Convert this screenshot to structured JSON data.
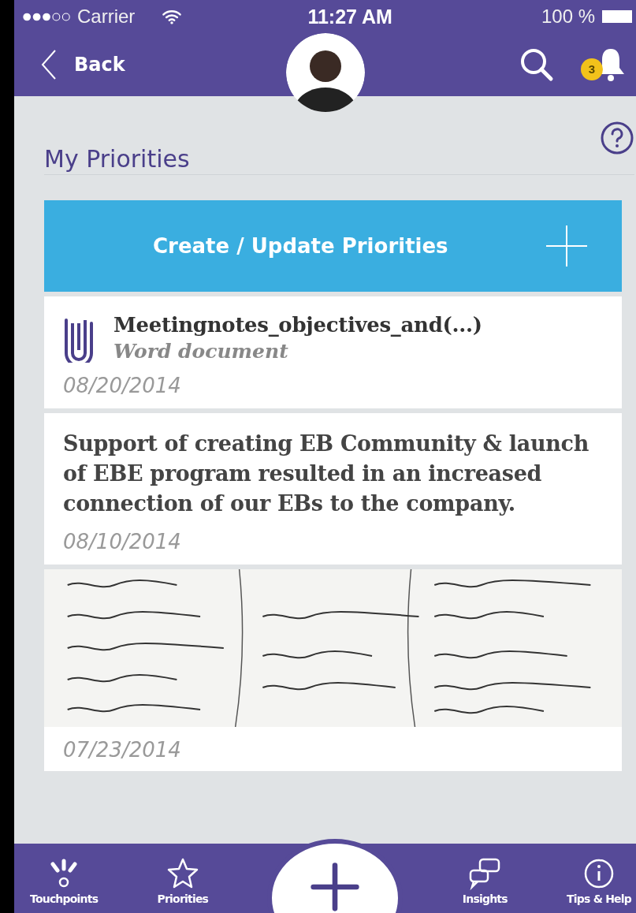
{
  "status_bar": {
    "carrier": "Carrier",
    "time": "11:27 AM",
    "battery": "100 %"
  },
  "nav_bar": {
    "back": "Back",
    "notifications": "3"
  },
  "page_title": "My Priorities",
  "create_button": "Create / Update Priorities",
  "cards": [
    {
      "kind": "attachment",
      "title": "Meetingnotes_objectives_and(...)",
      "subtitle": "Word document",
      "date": "08/20/2014"
    },
    {
      "kind": "note",
      "text": "Support of creating EB Community & launch of EBE program resulted in an increased connection of our EBs to the company.",
      "date": "08/10/2014"
    },
    {
      "date": "07/23/2014"
    }
  ],
  "tab_bar": [
    {
      "kind": "touchpoints",
      "label": "Touchpoints"
    },
    {
      "kind": "priorities",
      "label": "Priorities"
    },
    {
      "kind": "add"
    },
    {
      "kind": "insights",
      "label": "Insights"
    },
    {
      "kind": "help",
      "label": "Tips & Help"
    }
  ]
}
